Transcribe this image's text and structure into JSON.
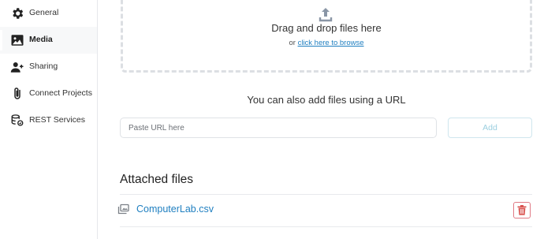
{
  "sidebar": {
    "items": [
      {
        "label": "General",
        "icon": "gear-icon",
        "active": false
      },
      {
        "label": "Media",
        "icon": "image-icon",
        "active": true
      },
      {
        "label": "Sharing",
        "icon": "add-user-icon",
        "active": false
      },
      {
        "label": "Connect Projects",
        "icon": "paperclip-icon",
        "active": false
      },
      {
        "label": "REST Services",
        "icon": "rest-services-icon",
        "active": false
      }
    ]
  },
  "upload": {
    "icon": "upload-icon",
    "drag_text": "Drag and drop files here",
    "or_text": "or",
    "browse_link": "click here to browse"
  },
  "url_section": {
    "heading": "You can also add files using a URL",
    "placeholder": "Paste URL here",
    "add_label": "Add"
  },
  "attached": {
    "heading": "Attached files",
    "files": [
      {
        "name": "ComputerLab.csv",
        "icon": "file-icon",
        "delete_icon": "trash-icon"
      }
    ]
  },
  "colors": {
    "link": "#1f7fc0",
    "delete": "#d9534f",
    "add_button_text": "#9ccfe0",
    "dashed_border": "#dcdfe3"
  }
}
